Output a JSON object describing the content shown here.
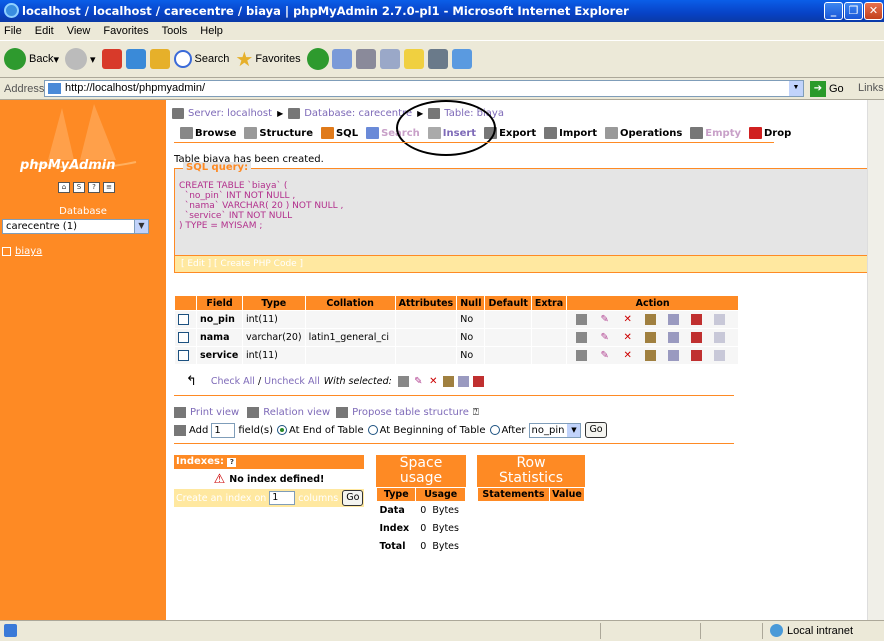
{
  "window": {
    "title": "localhost / localhost / carecentre / biaya | phpMyAdmin 2.7.0-pl1 - Microsoft Internet Explorer"
  },
  "menu": [
    "File",
    "Edit",
    "View",
    "Favorites",
    "Tools",
    "Help"
  ],
  "toolbar": {
    "back": "Back",
    "search": "Search",
    "favorites": "Favorites"
  },
  "address": {
    "label": "Address",
    "url": "http://localhost/phpmyadmin/",
    "go": "Go",
    "links": "Links"
  },
  "left": {
    "logo_text": "phpMyAdmin",
    "database_label": "Database",
    "database_selected": "carecentre (1)",
    "tables": [
      "biaya"
    ]
  },
  "breadcrumb": {
    "server": "Server: localhost",
    "database": "Database: carecentre",
    "table": "Table: biaya"
  },
  "tabs": [
    "Browse",
    "Structure",
    "SQL",
    "Search",
    "Insert",
    "Export",
    "Import",
    "Operations",
    "Empty",
    "Drop"
  ],
  "message": "Table biaya has been created.",
  "sql_query": {
    "legend": "SQL query:",
    "lines": [
      "CREATE TABLE `biaya` (",
      "  `no_pin` INT NOT NULL ,",
      "  `nama` VARCHAR( 20 ) NOT NULL ,",
      "  `service` INT NOT NULL",
      ") TYPE = MYISAM ;"
    ],
    "links": "[ Edit ] [ Create PHP Code ]"
  },
  "fields": {
    "headers": [
      "Field",
      "Type",
      "Collation",
      "Attributes",
      "Null",
      "Default",
      "Extra",
      "Action"
    ],
    "rows": [
      {
        "field": "no_pin",
        "type": "int(11)",
        "collation": "",
        "attributes": "",
        "null": "No",
        "default": "",
        "extra": ""
      },
      {
        "field": "nama",
        "type": "varchar(20)",
        "collation": "latin1_general_ci",
        "attributes": "",
        "null": "No",
        "default": "",
        "extra": ""
      },
      {
        "field": "service",
        "type": "int(11)",
        "collation": "",
        "attributes": "",
        "null": "No",
        "default": "",
        "extra": ""
      }
    ]
  },
  "check": {
    "check_all": "Check All",
    "slash": "/",
    "uncheck_all": "Uncheck All",
    "with_selected": "With selected:"
  },
  "links2": {
    "print_view": "Print view",
    "relation_view": "Relation view",
    "propose": "Propose table structure"
  },
  "add_fields": {
    "add": "Add",
    "count": "1",
    "fields": "field(s)",
    "end": "At End of Table",
    "begin": "At Beginning of Table",
    "after": "After",
    "after_field": "no_pin",
    "go": "Go"
  },
  "indexes": {
    "label": "Indexes:",
    "none": "No index defined!",
    "create": "Create an index on",
    "count": "1",
    "columns": "columns",
    "go": "Go"
  },
  "space_usage": {
    "title_1": "Space",
    "title_2": "usage",
    "headers": [
      "Type",
      "Usage"
    ],
    "rows": [
      {
        "type": "Data",
        "value": "0",
        "unit": "Bytes"
      },
      {
        "type": "Index",
        "value": "0",
        "unit": "Bytes"
      },
      {
        "type": "Total",
        "value": "0",
        "unit": "Bytes"
      }
    ]
  },
  "row_stats": {
    "title_1": "Row",
    "title_2": "Statistics",
    "headers": [
      "Statements",
      "Value"
    ]
  },
  "status": {
    "zone": "Local intranet"
  }
}
